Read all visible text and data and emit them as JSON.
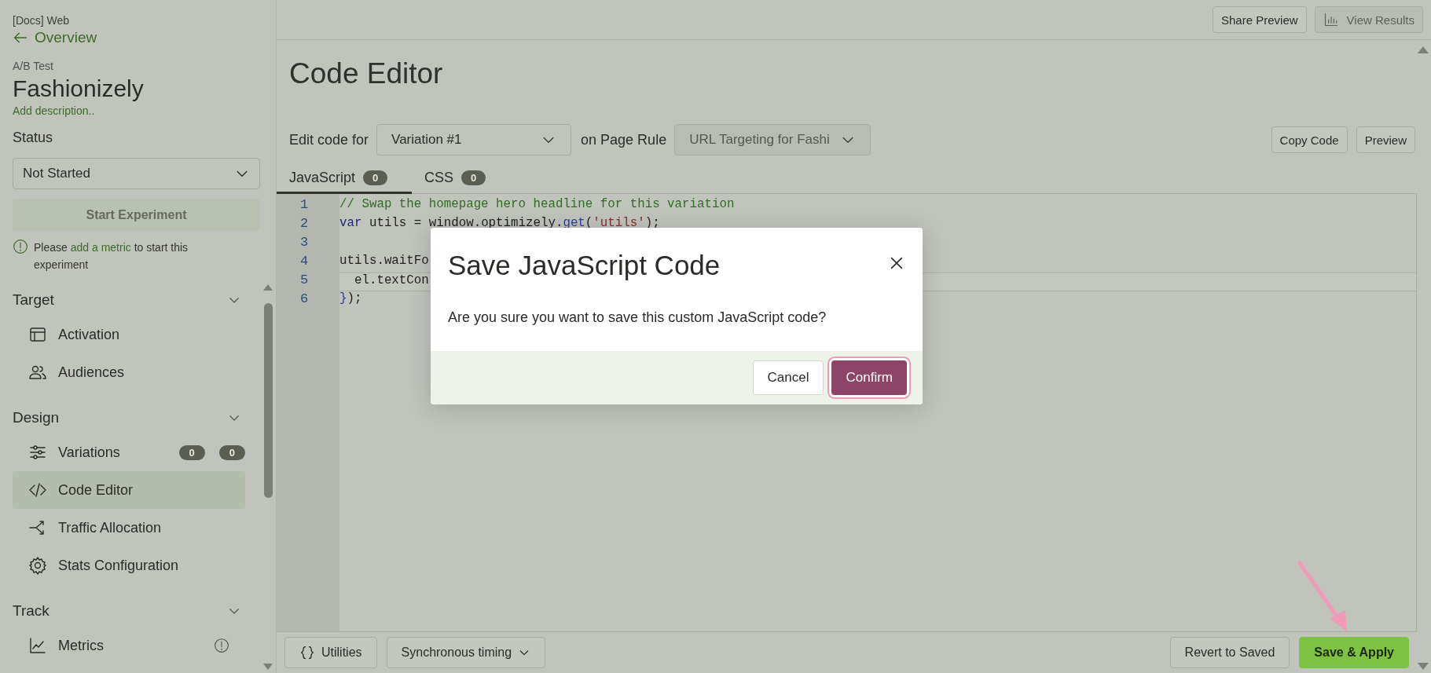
{
  "sidebar": {
    "project": "[Docs] Web",
    "back_link": "Overview",
    "experiment_type": "A/B Test",
    "experiment_name": "Fashionizely",
    "description_link": "Add description..",
    "status_label": "Status",
    "status_select": "Not Started",
    "start_button": {
      "label": "Start Experiment",
      "disabled": true
    },
    "notice": {
      "before": "Please",
      "link": "add a metric",
      "after": "to start this experiment"
    },
    "sections": [
      {
        "title": "Target",
        "expanded": true,
        "items": [
          {
            "label": "Activation",
            "selected": false
          },
          {
            "label": "Audiences",
            "selected": false
          }
        ]
      },
      {
        "title": "Design",
        "expanded": true,
        "items": [
          {
            "label": "Variations",
            "selected": false,
            "badges": [
              "0",
              "0"
            ]
          },
          {
            "label": "Code Editor",
            "selected": true
          },
          {
            "label": "Traffic Allocation",
            "selected": false
          },
          {
            "label": "Stats Configuration",
            "selected": false
          }
        ]
      },
      {
        "title": "Track",
        "expanded": true,
        "items": [
          {
            "label": "Metrics",
            "selected": false,
            "warning": true
          }
        ]
      }
    ]
  },
  "top_bar": {
    "buttons": [
      {
        "label": "Share Preview",
        "disabled": false
      },
      {
        "label": "View Results",
        "disabled": true
      }
    ]
  },
  "page_title": "Code Editor",
  "edit_row": {
    "label": "Edit code for",
    "variation_select": {
      "value": "Variation #1",
      "disabled": false
    },
    "page_rule_label": "on Page Rule",
    "page_rule_select": {
      "value": "URL Targeting for Fashi",
      "disabled": true
    },
    "actions": [
      "Copy Code",
      "Preview"
    ]
  },
  "tabs": [
    {
      "label": "JavaScript",
      "count": "0",
      "selected": true
    },
    {
      "label": "CSS",
      "count": "0",
      "selected": false
    }
  ],
  "editor": {
    "lines": [
      {
        "number": "1",
        "active": false,
        "tokens": [
          {
            "kind": "comment",
            "text": "// Swap the homepage hero headline for this variation"
          }
        ]
      },
      {
        "number": "2",
        "active": false,
        "tokens": [
          {
            "kind": "keyword",
            "text": "var"
          },
          {
            "kind": "plain",
            "text": " utils = window.optimizely."
          },
          {
            "kind": "property",
            "text": "get"
          },
          {
            "kind": "plain",
            "text": "("
          },
          {
            "kind": "string",
            "text": "'utils'"
          },
          {
            "kind": "plain",
            "text": ");"
          }
        ]
      },
      {
        "number": "3",
        "active": false
      },
      {
        "number": "4",
        "active": false,
        "tokens": [
          {
            "kind": "plain",
            "text": "utils.waitFo"
          }
        ]
      },
      {
        "number": "5",
        "active": true,
        "tokens": [
          {
            "kind": "plain",
            "text": "  el.textCon"
          }
        ]
      },
      {
        "number": "6",
        "active": false,
        "tokens": [
          {
            "kind": "bracket",
            "text": "}"
          },
          {
            "kind": "plain",
            "text": ");"
          }
        ]
      }
    ]
  },
  "dialog": {
    "title": "Save JavaScript Code",
    "message": "Are you sure you want to save this custom JavaScript code?",
    "buttons": [
      {
        "label": "Cancel",
        "kind": "secondary",
        "focused": false
      },
      {
        "label": "Confirm",
        "kind": "primary",
        "focused": true
      }
    ]
  },
  "bottom_bar": {
    "left": [
      {
        "label": "Utilities"
      },
      {
        "label": "Synchronous timing"
      }
    ],
    "right": [
      {
        "label": "Revert to Saved",
        "kind": "secondary"
      },
      {
        "label": "Save & Apply",
        "kind": "primary",
        "pointed": true
      }
    ]
  }
}
